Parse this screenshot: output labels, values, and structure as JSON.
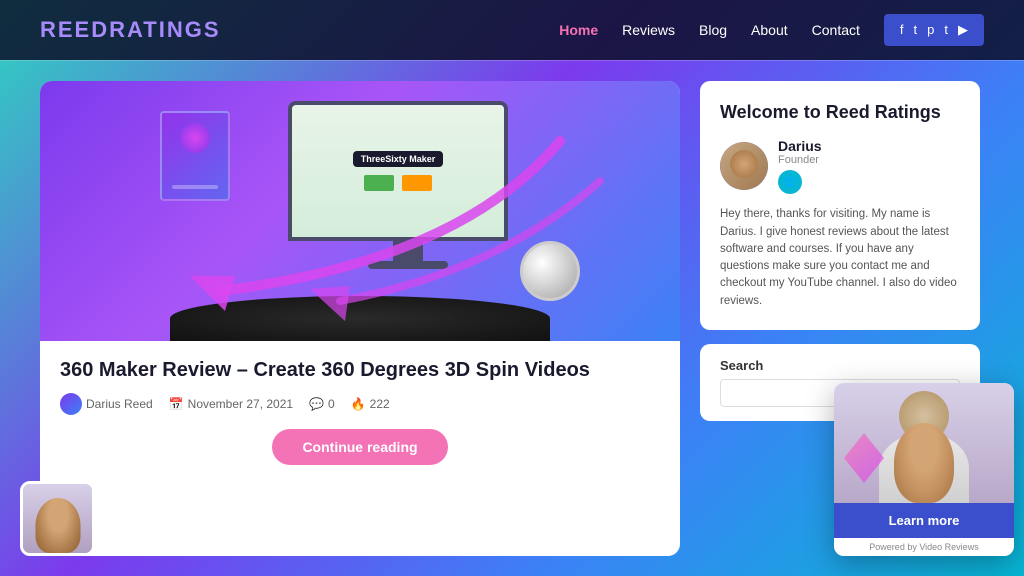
{
  "header": {
    "logo_text": "ReedRatings",
    "logo_prefix": "Reed",
    "logo_suffix": "Ratings",
    "nav": {
      "items": [
        {
          "label": "Home",
          "active": true
        },
        {
          "label": "Reviews",
          "active": false
        },
        {
          "label": "Blog",
          "active": false
        },
        {
          "label": "About",
          "active": false
        },
        {
          "label": "Contact",
          "active": false
        }
      ]
    },
    "social": [
      "f",
      "t",
      "p",
      "t",
      "yt"
    ]
  },
  "article": {
    "title": "360 Maker Review – Create 360 Degrees 3D Spin Videos",
    "author": "Darius Reed",
    "date": "November 27, 2021",
    "comments": "0",
    "views": "222",
    "continue_label": "Continue reading"
  },
  "sidebar": {
    "welcome_title": "Welcome to Reed Ratings",
    "author_name": "Darius",
    "author_role": "Founder",
    "bio_text": "Hey there, thanks for visiting. My name is Darius. I give honest reviews about the latest software and courses. If you have any questions make sure you contact me and checkout my YouTube channel. I also do video reviews.",
    "search_label": "Search",
    "search_placeholder": ""
  },
  "video_widget": {
    "learn_more_label": "Learn more",
    "footer_text": "Powered by Video Reviews"
  }
}
